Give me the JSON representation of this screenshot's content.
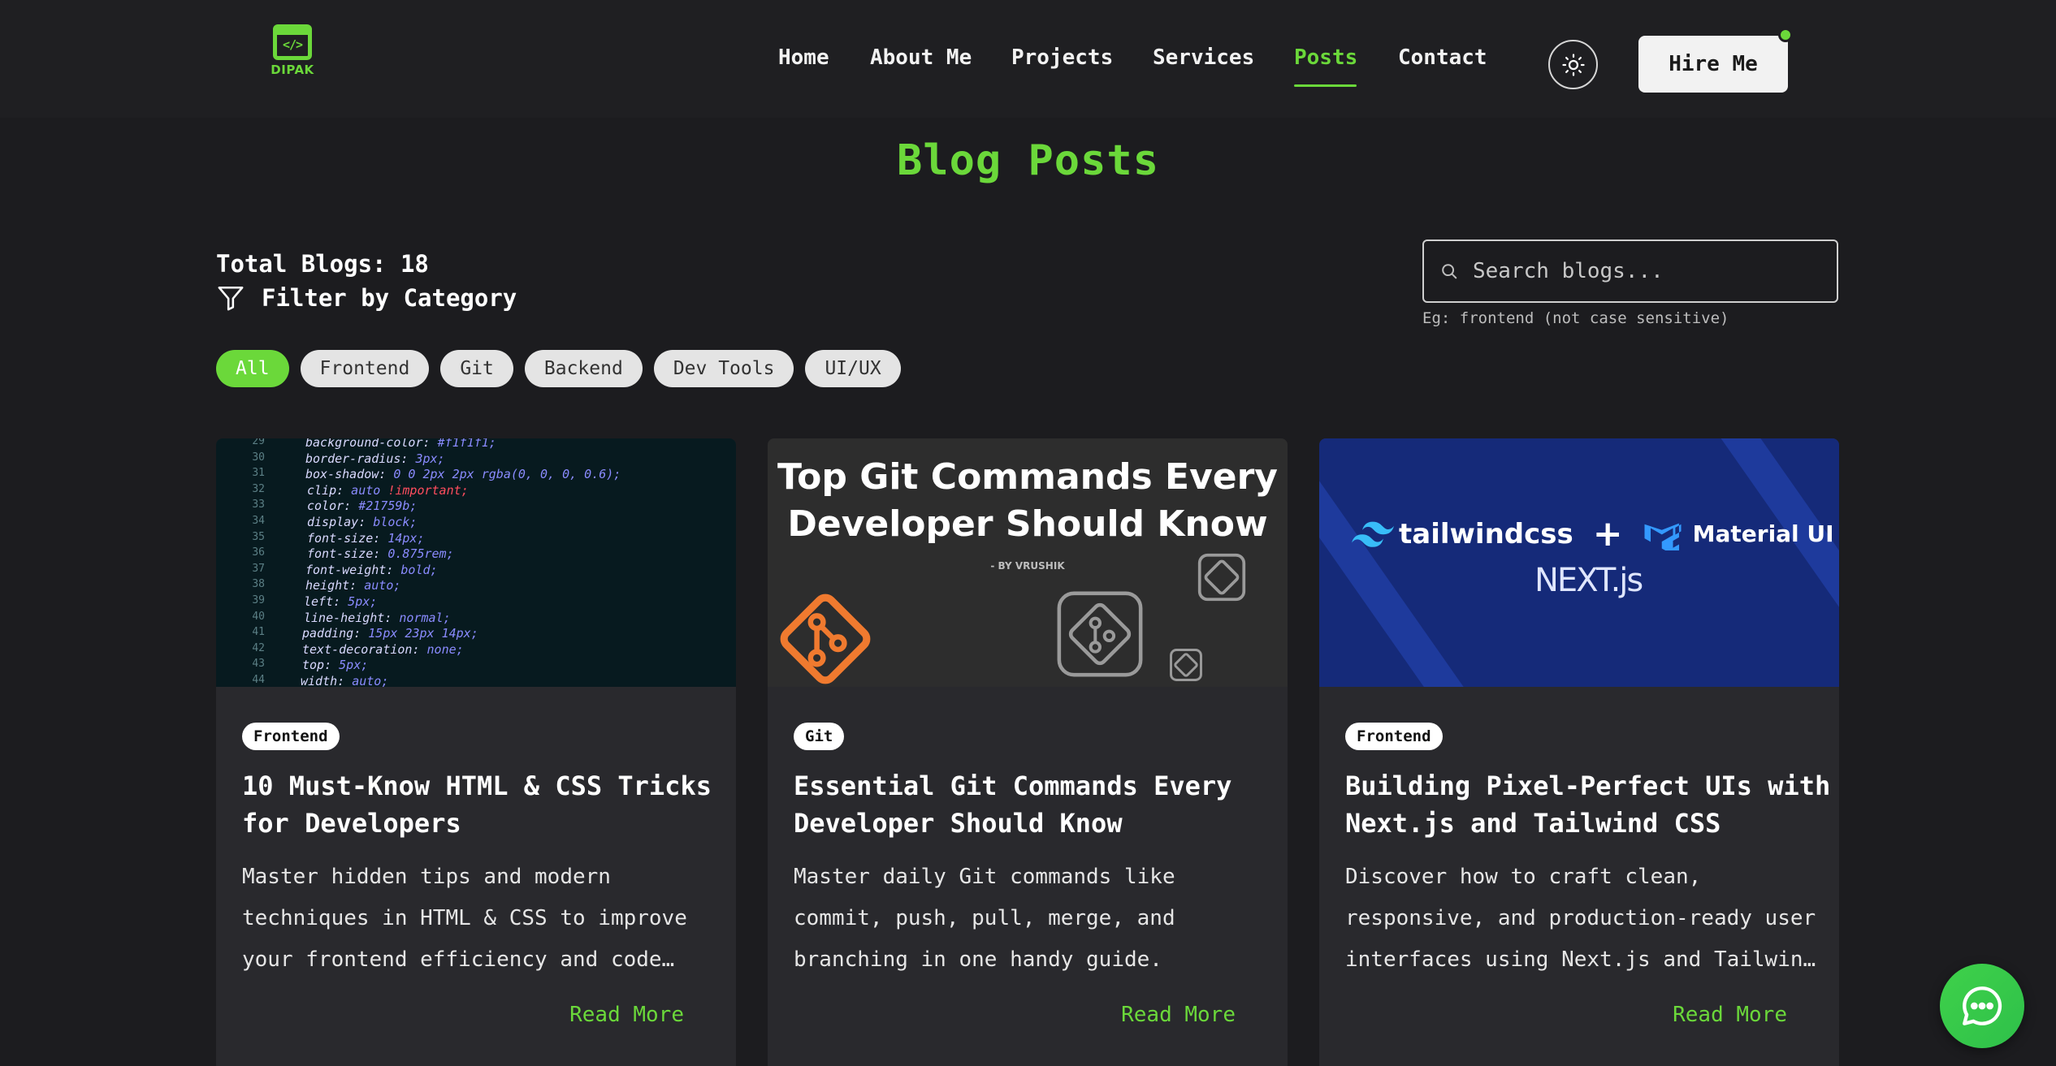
{
  "brand": {
    "logo_text": "DIPAK",
    "logo_glyph": "</>"
  },
  "nav": {
    "items": [
      {
        "label": "Home",
        "active": false
      },
      {
        "label": "About Me",
        "active": false
      },
      {
        "label": "Projects",
        "active": false
      },
      {
        "label": "Services",
        "active": false
      },
      {
        "label": "Posts",
        "active": true
      },
      {
        "label": "Contact",
        "active": false
      }
    ],
    "theme_toggle_icon": "sun-icon",
    "hire_label": "Hire Me"
  },
  "page": {
    "title": "Blog Posts",
    "total_label": "Total Blogs: 18",
    "filter_label": "Filter by Category"
  },
  "search": {
    "placeholder": "Search blogs...",
    "value": "",
    "hint": "Eg: frontend (not case sensitive)"
  },
  "categories": [
    {
      "label": "All",
      "active": true
    },
    {
      "label": "Frontend",
      "active": false
    },
    {
      "label": "Git",
      "active": false
    },
    {
      "label": "Backend",
      "active": false
    },
    {
      "label": "Dev Tools",
      "active": false
    },
    {
      "label": "UI/UX",
      "active": false
    }
  ],
  "posts": [
    {
      "tag": "Frontend",
      "title": "10 Must-Know HTML & CSS Tricks for Developers",
      "description": "Master hidden tips and modern techniques in HTML & CSS to improve your frontend efficiency and code…",
      "read_more": "Read More",
      "image": {
        "type": "code-screenshot",
        "lines": [
          {
            "n": "29",
            "prop": "background-color:",
            "val": " #f1f1f1;"
          },
          {
            "n": "30",
            "prop": "border-radius:",
            "val": " 3px;"
          },
          {
            "n": "31",
            "prop": "box-shadow:",
            "val": " 0 0 2px 2px rgba(0, 0, 0, 0.6);"
          },
          {
            "n": "32",
            "prop": "clip:",
            "val": " auto",
            "imp": " !important;"
          },
          {
            "n": "33",
            "prop": "color:",
            "val": " #21759b;"
          },
          {
            "n": "34",
            "prop": "display:",
            "val": " block;"
          },
          {
            "n": "35",
            "prop": "font-size:",
            "val": " 14px;"
          },
          {
            "n": "36",
            "prop": "font-size:",
            "val": " 0.875rem;"
          },
          {
            "n": "37",
            "prop": "font-weight:",
            "val": " bold;"
          },
          {
            "n": "38",
            "prop": "height:",
            "val": " auto;"
          },
          {
            "n": "39",
            "prop": "left:",
            "val": " 5px;"
          },
          {
            "n": "40",
            "prop": "line-height:",
            "val": " normal;"
          },
          {
            "n": "41",
            "prop": "padding:",
            "val": " 15px 23px 14px;"
          },
          {
            "n": "42",
            "prop": "text-decoration:",
            "val": " none;"
          },
          {
            "n": "43",
            "prop": "top:",
            "val": " 5px;"
          },
          {
            "n": "44",
            "prop": "width:",
            "val": " auto;"
          }
        ]
      }
    },
    {
      "tag": "Git",
      "title": "Essential Git Commands Every Developer Should Know",
      "description": "Master daily Git commands like commit, push, pull, merge, and branching in one handy guide.",
      "read_more": "Read More",
      "image": {
        "type": "git-banner",
        "heading_line1": "Top Git Commands Every",
        "heading_line2": "Developer Should Know",
        "byline": "- BY VRUSHIK"
      }
    },
    {
      "tag": "Frontend",
      "title": "Building Pixel-Perfect UIs with Next.js and Tailwind CSS",
      "description": "Discover how to craft clean, responsive, and production-ready user interfaces using Next.js and Tailwin…",
      "read_more": "Read More",
      "image": {
        "type": "stack-banner",
        "tailwind": "tailwindcss",
        "plus": "+",
        "mui": "Material UI",
        "next": "NEXT.js"
      }
    }
  ],
  "chat": {
    "icon": "chat-bubble-icon"
  },
  "colors": {
    "accent": "#6bd83a",
    "background": "#1c1c1f",
    "card": "#29292d"
  }
}
